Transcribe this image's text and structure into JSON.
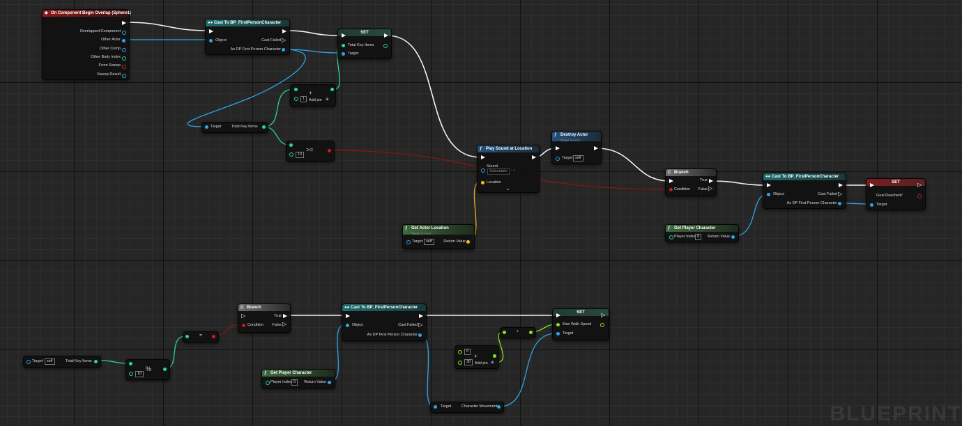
{
  "nodes": {
    "event": {
      "title": "On Component Begin Overlap (Sphere1)",
      "pins": [
        "Overlapped Component",
        "Other Actor",
        "Other Comp",
        "Other Body Index",
        "From Sweep",
        "Sweep Result"
      ]
    },
    "cast1": {
      "title": "Cast To BP_FirstPersonCharacter",
      "object": "Object",
      "cast_failed": "Cast Failed",
      "as_dp": "As DP First Person Character"
    },
    "set1": {
      "title": "SET",
      "total_key_items": "Total Key Items",
      "target": "Target"
    },
    "add1": {
      "value": "1",
      "add_pin": "Add pin"
    },
    "getter1": {
      "target": "Target",
      "total_key_items": "Total Key Items"
    },
    "compare": {
      "op": ">=",
      "value": "13"
    },
    "play_sound": {
      "title": "Play Sound at Location",
      "sound": "Sound",
      "sound_value": "Selectable",
      "location": "Location"
    },
    "destroy": {
      "title": "Destroy Actor",
      "subtitle": "Target is Actor",
      "target": "Target",
      "target_value": "self"
    },
    "branch1": {
      "title": "Branch",
      "condition": "Condition",
      "true": "True",
      "false": "False"
    },
    "cast2": {
      "title": "Cast To BP_FirstPersonCharacter",
      "object": "Object",
      "cast_failed": "Cast Failed",
      "as_dp": "As DP First Person Character"
    },
    "set2": {
      "title": "SET",
      "goal_reached": "Goal Reached",
      "target": "Target"
    },
    "get_actor_location": {
      "title": "Get Actor Location",
      "subtitle": "Target is Actor",
      "target": "Target",
      "target_value": "self",
      "return_value": "Return Value"
    },
    "get_player1": {
      "title": "Get Player Character",
      "player_index": "Player Index",
      "player_index_value": "0",
      "return_value": "Return Value"
    },
    "getter2": {
      "target": "Target",
      "target_value": "self",
      "total_key_items": "Total Key Items"
    },
    "modulo": {
      "op": "%",
      "value": "10"
    },
    "equal": {
      "op": "="
    },
    "branch2": {
      "title": "Branch",
      "condition": "Condition",
      "true": "True",
      "false": "False"
    },
    "cast3": {
      "title": "Cast To BP_FirstPersonCharacter",
      "object": "Object",
      "cast_failed": "Cast Failed",
      "as_dp": "As DP First Person Character"
    },
    "get_player2": {
      "title": "Get Player Character",
      "player_index": "Player Index",
      "player_index_value": "0",
      "return_value": "Return Value"
    },
    "add2": {
      "value_a": "0",
      "value_b": "30",
      "add_pin": "Add pin"
    },
    "multiply": {
      "op": "*"
    },
    "set3": {
      "title": "SET",
      "max_walk_speed": "Max Walk Speed",
      "target": "Target"
    },
    "char_movement": {
      "target": "Target",
      "char_movement": "Character Movement"
    }
  },
  "watermark": "BLUEPRINT",
  "colors": {
    "exec": "#ffffff",
    "object": "#2fa4e7",
    "int": "#2bd4a0",
    "bool": "#c41e1e",
    "vector": "#f0c020",
    "float": "#8ce21e"
  }
}
